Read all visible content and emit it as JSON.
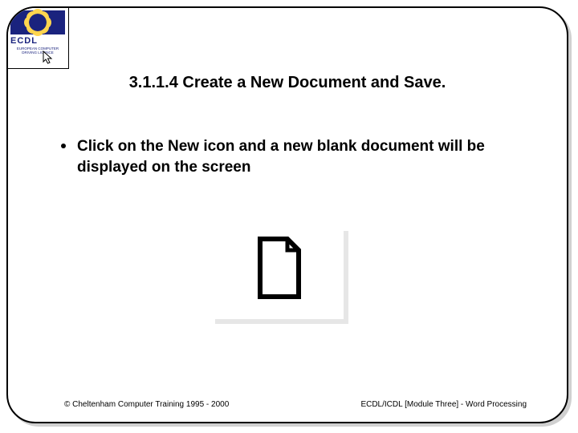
{
  "logo": {
    "acronym": "ECDL",
    "subtitle": "EUROPEAN COMPUTER DRIVING LICENCE"
  },
  "title": "3.1.1.4 Create a New Document and Save.",
  "bullet": {
    "pre": "Click on the ",
    "keyword": "New",
    "post": " icon and a new blank document will be displayed on the screen"
  },
  "icon_name": "new-document",
  "footer": {
    "left": "© Cheltenham Computer Training 1995 - 2000",
    "right": "ECDL/ICDL [Module Three]  - Word Processing"
  }
}
